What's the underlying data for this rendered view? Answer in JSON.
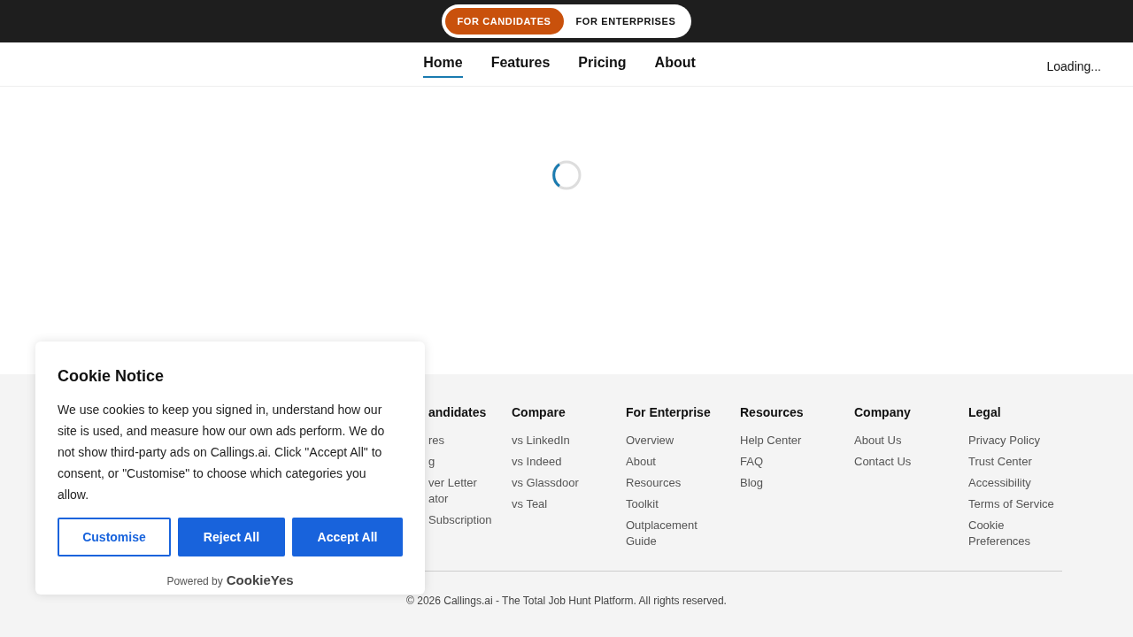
{
  "mode_switch": [
    {
      "label": "FOR CANDIDATES",
      "selected": true
    },
    {
      "label": "FOR ENTERPRISES",
      "selected": false
    }
  ],
  "nav": {
    "links": [
      {
        "label": "Home",
        "selected": true
      },
      {
        "label": "Features",
        "selected": false
      },
      {
        "label": "Pricing",
        "selected": false
      },
      {
        "label": "About",
        "selected": false
      }
    ],
    "status": "Loading..."
  },
  "footer": {
    "columns": [
      {
        "heading": "andidates",
        "links": [
          "res",
          "g",
          "ver Letter ator",
          "Subscription"
        ]
      },
      {
        "heading": "Compare",
        "links": [
          "vs LinkedIn",
          "vs Indeed",
          "vs Glassdoor",
          "vs Teal"
        ]
      },
      {
        "heading": "For Enterprise",
        "links": [
          "Overview",
          "About",
          "Resources",
          "Toolkit",
          "Outplacement Guide"
        ]
      },
      {
        "heading": "Resources",
        "links": [
          "Help Center",
          "FAQ",
          "Blog"
        ]
      },
      {
        "heading": "Company",
        "links": [
          "About Us",
          "Contact Us"
        ]
      },
      {
        "heading": "Legal",
        "links": [
          "Privacy Policy",
          "Trust Center",
          "Accessibility",
          "Terms of Service",
          "Cookie Preferences"
        ]
      }
    ],
    "copyright": "© 2026 Callings.ai - The Total Job Hunt Platform. All rights reserved."
  },
  "cookie_notice": {
    "title": "Cookie Notice",
    "text": "We use cookies to keep you signed in, understand how our site is used, and measure how our own ads perform. We do not show third-party ads on Callings.ai. Click \"Accept All\" to consent, or \"Customise\" to choose which categories you allow.",
    "buttons": [
      {
        "label": "Customise",
        "kind": "outline"
      },
      {
        "label": "Reject All",
        "kind": "solid"
      },
      {
        "label": "Accept All",
        "kind": "solid"
      }
    ],
    "powered_by": "Powered by",
    "brand": "CookieYes"
  }
}
